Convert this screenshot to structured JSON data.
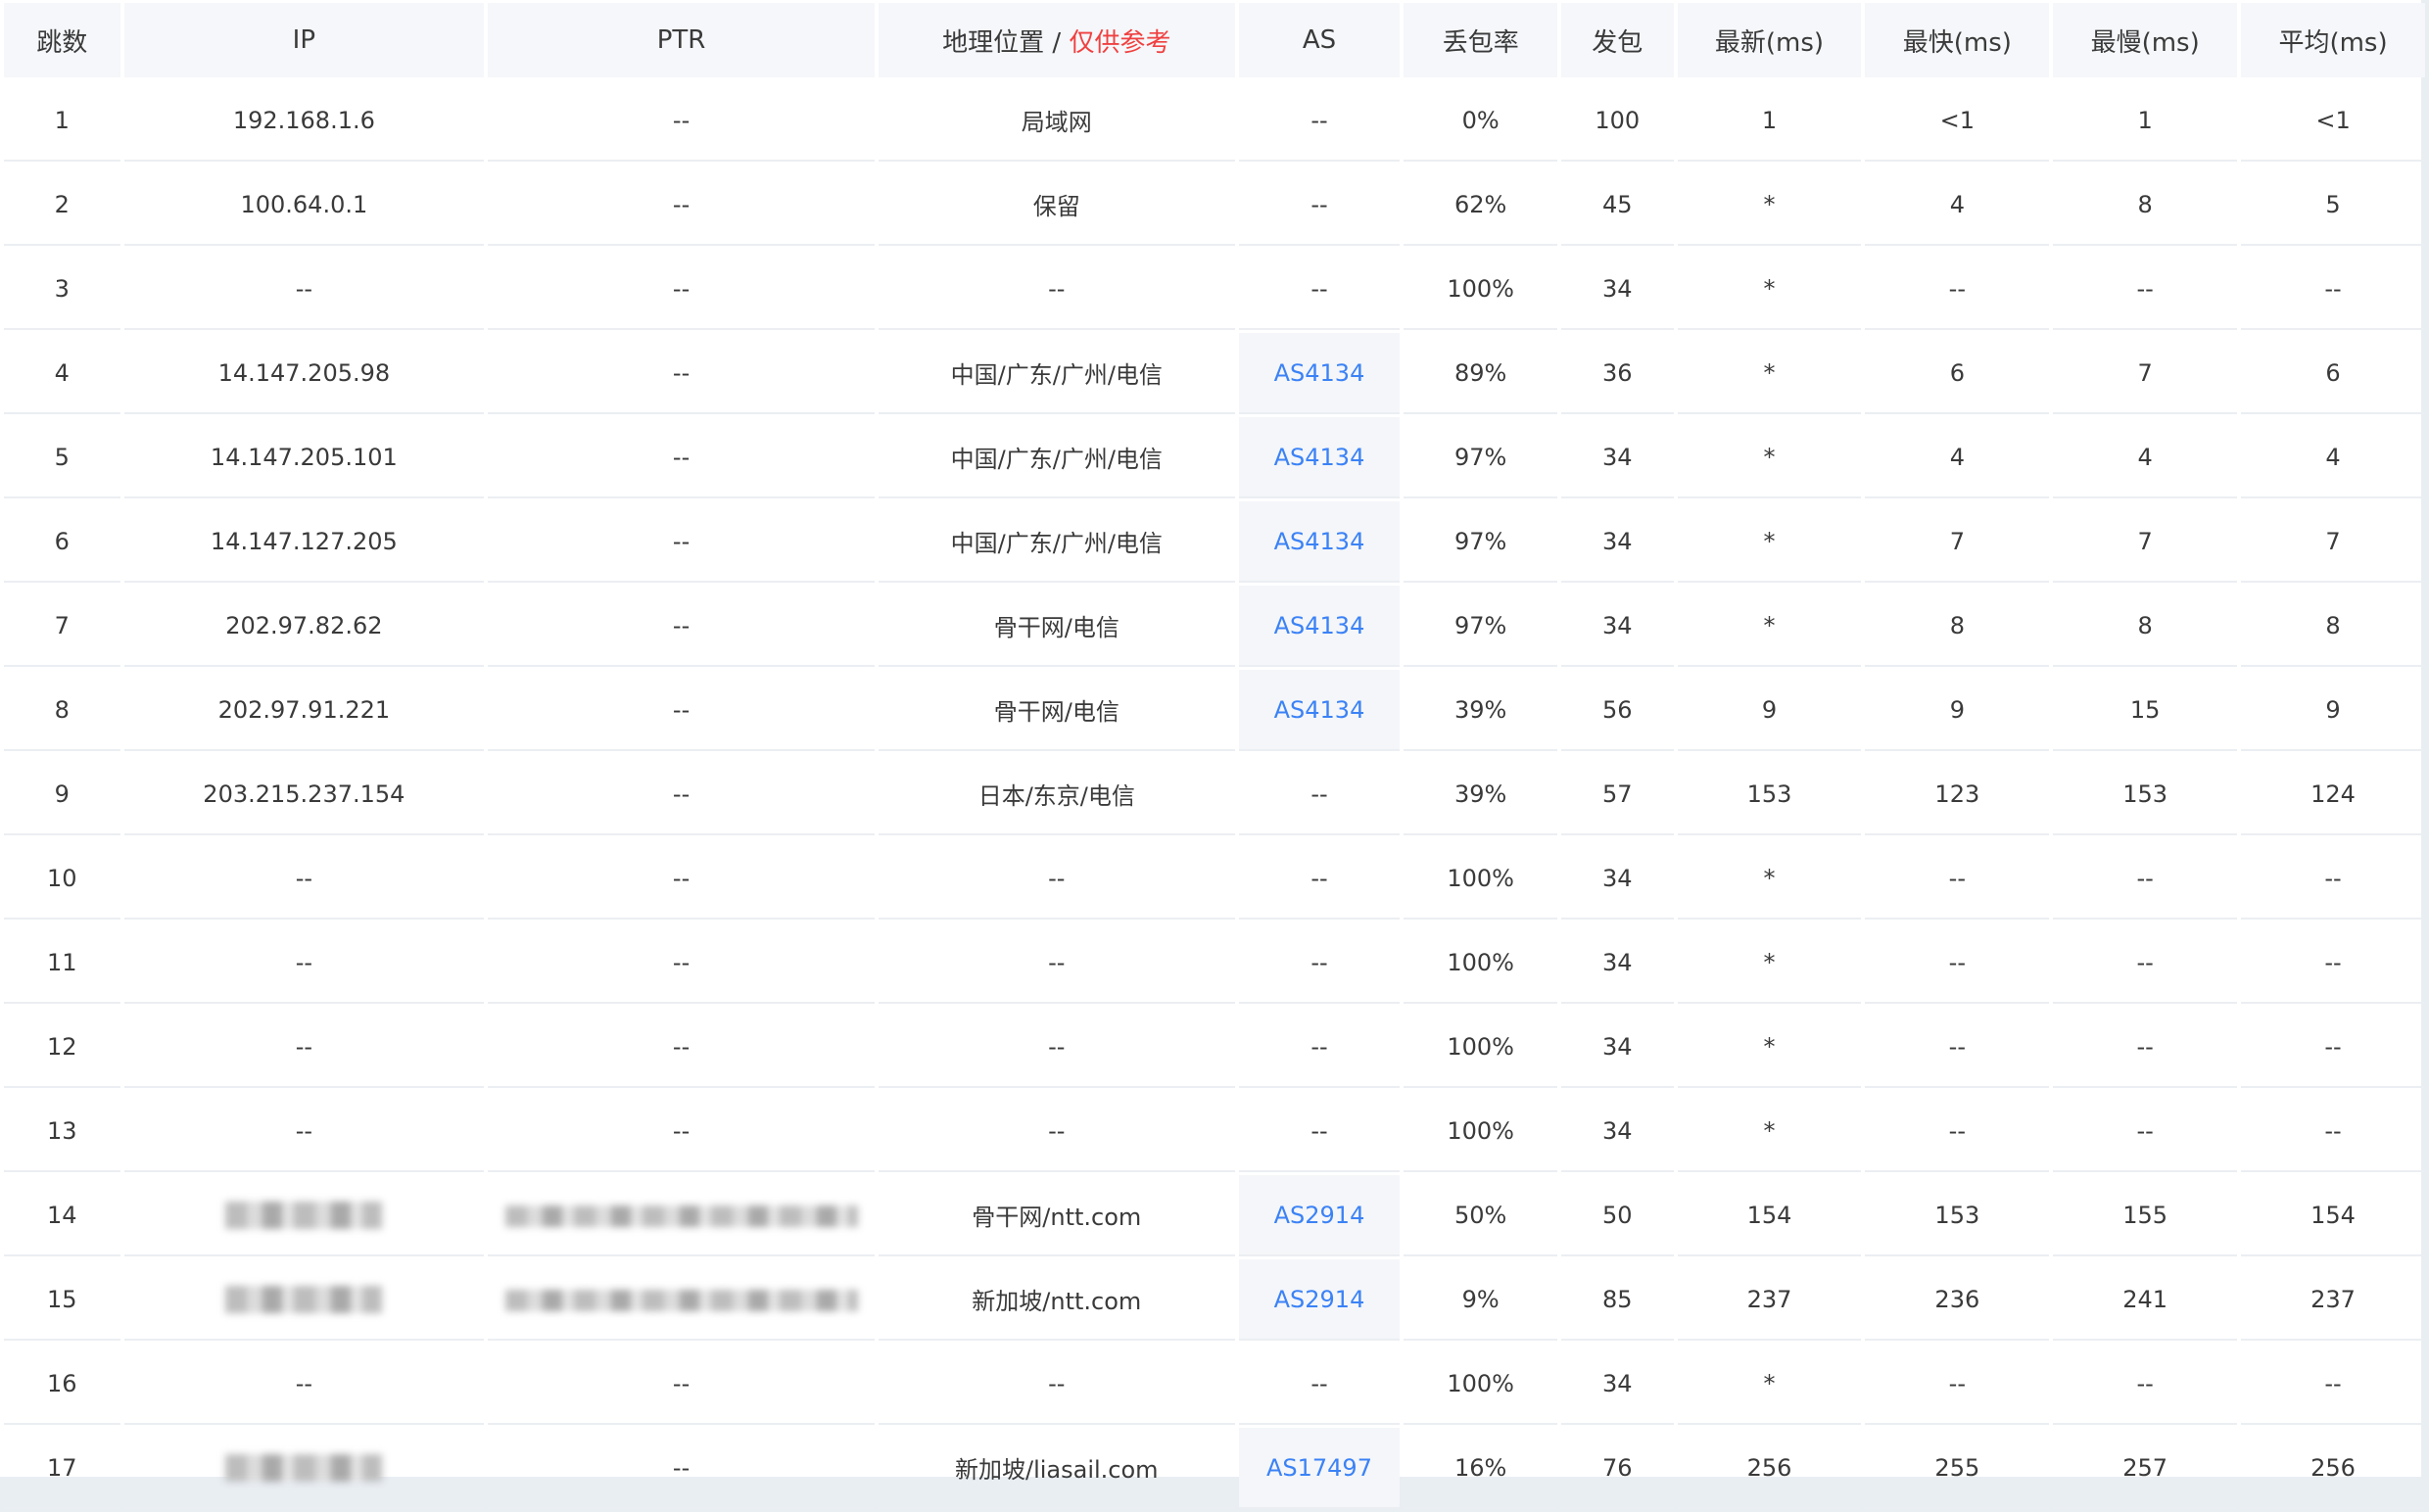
{
  "headers": {
    "hop": "跳数",
    "ip": "IP",
    "ptr": "PTR",
    "geo": "地理位置",
    "geo_sep": " / ",
    "geo_note": "仅供参考",
    "as": "AS",
    "loss": "丢包率",
    "sent": "发包",
    "last": "最新(ms)",
    "best": "最快(ms)",
    "worst": "最慢(ms)",
    "avg": "平均(ms)"
  },
  "colors": {
    "link": "#3b82f6",
    "note": "#f04040",
    "header_bg": "#f5f7fa"
  },
  "rows": [
    {
      "hop": "1",
      "ip": "192.168.1.6",
      "ptr": "--",
      "geo": "局域网",
      "as": "--",
      "loss": "0%",
      "sent": "100",
      "last": "1",
      "best": "<1",
      "worst": "1",
      "avg": "<1"
    },
    {
      "hop": "2",
      "ip": "100.64.0.1",
      "ptr": "--",
      "geo": "保留",
      "as": "--",
      "loss": "62%",
      "sent": "45",
      "last": "*",
      "best": "4",
      "worst": "8",
      "avg": "5"
    },
    {
      "hop": "3",
      "ip": "--",
      "ptr": "--",
      "geo": "--",
      "as": "--",
      "loss": "100%",
      "sent": "34",
      "last": "*",
      "best": "--",
      "worst": "--",
      "avg": "--"
    },
    {
      "hop": "4",
      "ip": "14.147.205.98",
      "ptr": "--",
      "geo": "中国/广东/广州/电信",
      "as": "AS4134",
      "loss": "89%",
      "sent": "36",
      "last": "*",
      "best": "6",
      "worst": "7",
      "avg": "6"
    },
    {
      "hop": "5",
      "ip": "14.147.205.101",
      "ptr": "--",
      "geo": "中国/广东/广州/电信",
      "as": "AS4134",
      "loss": "97%",
      "sent": "34",
      "last": "*",
      "best": "4",
      "worst": "4",
      "avg": "4"
    },
    {
      "hop": "6",
      "ip": "14.147.127.205",
      "ptr": "--",
      "geo": "中国/广东/广州/电信",
      "as": "AS4134",
      "loss": "97%",
      "sent": "34",
      "last": "*",
      "best": "7",
      "worst": "7",
      "avg": "7"
    },
    {
      "hop": "7",
      "ip": "202.97.82.62",
      "ptr": "--",
      "geo": "骨干网/电信",
      "as": "AS4134",
      "loss": "97%",
      "sent": "34",
      "last": "*",
      "best": "8",
      "worst": "8",
      "avg": "8"
    },
    {
      "hop": "8",
      "ip": "202.97.91.221",
      "ptr": "--",
      "geo": "骨干网/电信",
      "as": "AS4134",
      "loss": "39%",
      "sent": "56",
      "last": "9",
      "best": "9",
      "worst": "15",
      "avg": "9"
    },
    {
      "hop": "9",
      "ip": "203.215.237.154",
      "ptr": "--",
      "geo": "日本/东京/电信",
      "as": "--",
      "loss": "39%",
      "sent": "57",
      "last": "153",
      "best": "123",
      "worst": "153",
      "avg": "124"
    },
    {
      "hop": "10",
      "ip": "--",
      "ptr": "--",
      "geo": "--",
      "as": "--",
      "loss": "100%",
      "sent": "34",
      "last": "*",
      "best": "--",
      "worst": "--",
      "avg": "--"
    },
    {
      "hop": "11",
      "ip": "--",
      "ptr": "--",
      "geo": "--",
      "as": "--",
      "loss": "100%",
      "sent": "34",
      "last": "*",
      "best": "--",
      "worst": "--",
      "avg": "--"
    },
    {
      "hop": "12",
      "ip": "--",
      "ptr": "--",
      "geo": "--",
      "as": "--",
      "loss": "100%",
      "sent": "34",
      "last": "*",
      "best": "--",
      "worst": "--",
      "avg": "--"
    },
    {
      "hop": "13",
      "ip": "--",
      "ptr": "--",
      "geo": "--",
      "as": "--",
      "loss": "100%",
      "sent": "34",
      "last": "*",
      "best": "--",
      "worst": "--",
      "avg": "--"
    },
    {
      "hop": "14",
      "ip": "",
      "ptr": "",
      "geo": "骨干网/ntt.com",
      "as": "AS2914",
      "loss": "50%",
      "sent": "50",
      "last": "154",
      "best": "153",
      "worst": "155",
      "avg": "154"
    },
    {
      "hop": "15",
      "ip": "",
      "ptr": "",
      "geo": "新加坡/ntt.com",
      "as": "AS2914",
      "loss": "9%",
      "sent": "85",
      "last": "237",
      "best": "236",
      "worst": "241",
      "avg": "237"
    },
    {
      "hop": "16",
      "ip": "--",
      "ptr": "--",
      "geo": "--",
      "as": "--",
      "loss": "100%",
      "sent": "34",
      "last": "*",
      "best": "--",
      "worst": "--",
      "avg": "--"
    },
    {
      "hop": "17",
      "ip": "",
      "ptr": "--",
      "geo": "新加坡/liasail.com",
      "as": "AS17497",
      "loss": "16%",
      "sent": "76",
      "last": "256",
      "best": "255",
      "worst": "257",
      "avg": "256"
    }
  ]
}
